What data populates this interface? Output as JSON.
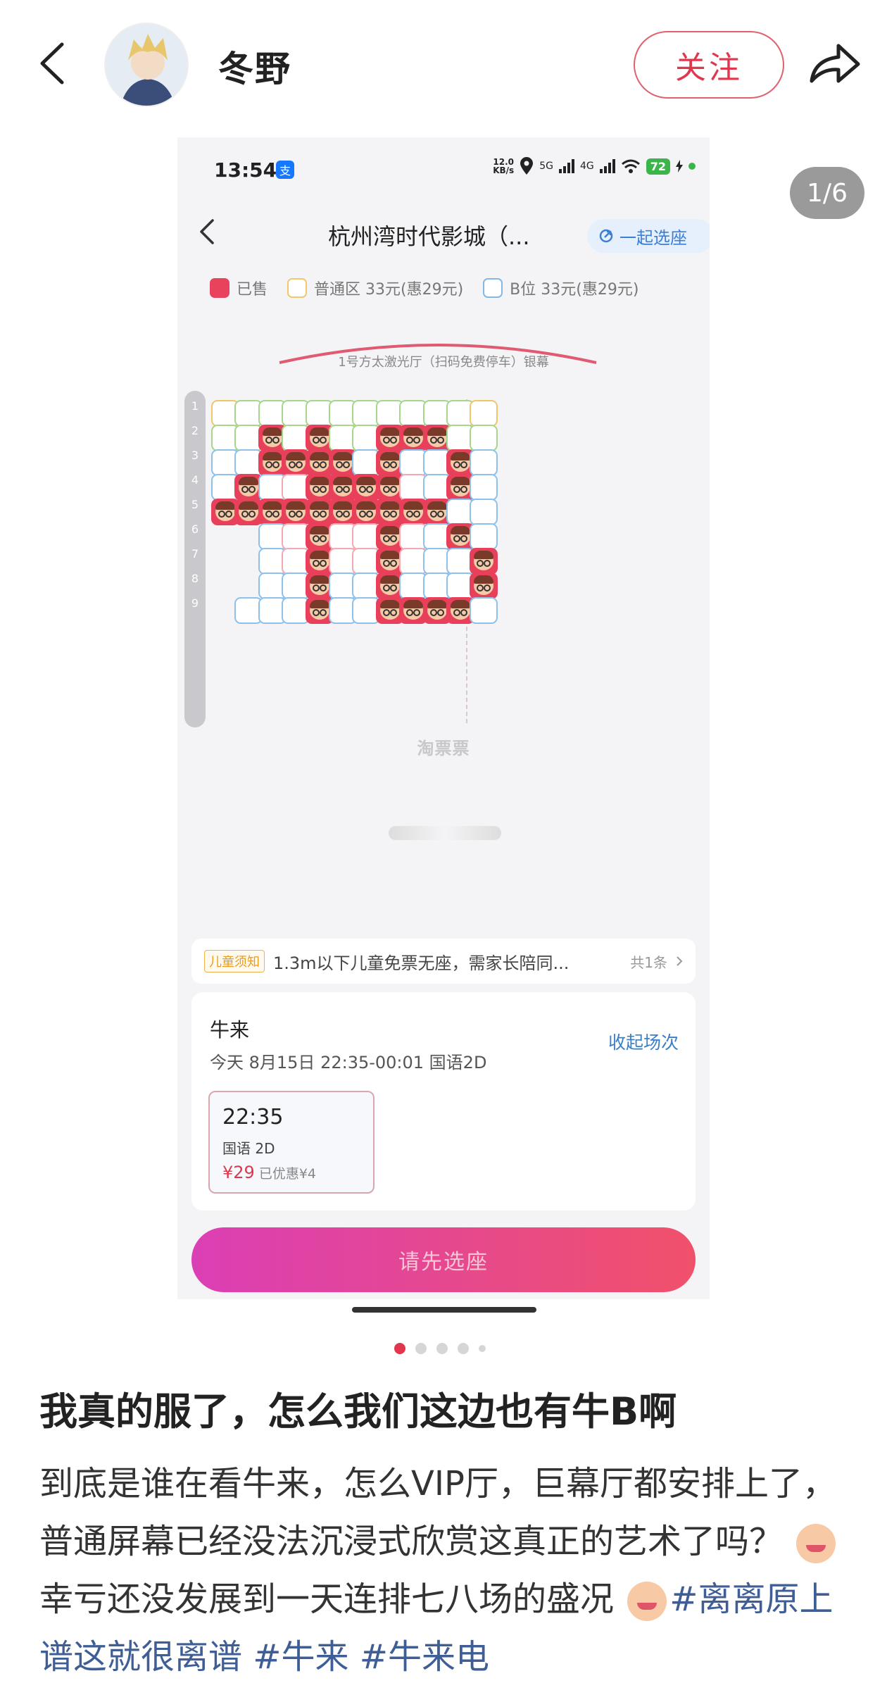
{
  "header": {
    "username": "冬野",
    "follow_label": "关注"
  },
  "carousel": {
    "page_counter": "1/6",
    "dots_total": 5,
    "active_dot": 0
  },
  "screenshot": {
    "status_bar": {
      "time": "13:54",
      "net_speed_value": "12.0",
      "net_speed_unit": "KB/s",
      "signal_1": "5G",
      "signal_2": "4G",
      "battery": "72"
    },
    "nav": {
      "title": "杭州湾时代影城（...",
      "together_label": "一起选座"
    },
    "legend": {
      "sold": "已售",
      "normal": "普通区 33元(惠29元)",
      "b": "B位 33元(惠29元)"
    },
    "screen_label": "1号方太激光厅（扫码免费停车）银幕",
    "rows": [
      "1",
      "2",
      "3",
      "4",
      "5",
      "6",
      "7",
      "8",
      "9"
    ],
    "seat_map": [
      "NGGGGGGGGGGN",
      "GGSGSGGSSSGG",
      "BBSSSSBSBBSB",
      "BSBPSSSSPBSB",
      "SSSSSSSSSSBB",
      "..BPSPPSPBSB",
      "..BPSPPSPBBS",
      "..BBSBBSBBBS",
      ".BBBSBBSSSSB"
    ],
    "watermark": "淘票票",
    "notice": {
      "tag": "儿童须知",
      "text": "1.3m以下儿童免票无座，需家长陪同...",
      "count": "共1条"
    },
    "movie": {
      "name": "牛来",
      "info": "今天 8月15日 22:35-00:01 国语2D",
      "collapse_label": "收起场次",
      "showtime": {
        "time": "22:35",
        "lang": "国语 2D",
        "price": "¥29",
        "discount": "已优惠¥4"
      }
    },
    "cta_label": "请先选座"
  },
  "post": {
    "title": "我真的服了，怎么我们这边也有牛B啊",
    "body_1": "到底是谁在看牛来，怎么VIP厅，巨幕厅都安排上了，普通屏幕已经没法沉浸式欣赏这真正的艺术了吗？",
    "body_2": "幸亏还没发展到一天连排七八场的盛况",
    "tags": "#离离原上谱这就很离谱 #牛来 #牛来电"
  },
  "colors": {
    "accent": "#e0374e",
    "sold_seat": "#e8405b",
    "normal_seat_border": "#f0c667",
    "b_seat_border": "#8dc0ea",
    "hashtag": "#3f5e96"
  }
}
